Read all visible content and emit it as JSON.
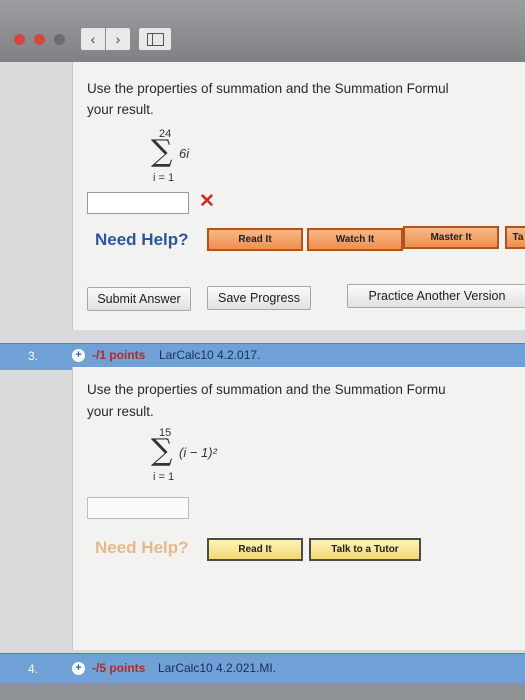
{
  "nav": {
    "back_glyph": "‹",
    "forward_glyph": "›"
  },
  "question2": {
    "prompt_line1": "Use the properties of summation and the Summation Formul",
    "prompt_line2": "your result.",
    "sum_upper": "24",
    "sum_lower": "i = 1",
    "sum_expr": "6i",
    "answer_value": "",
    "wrong_mark": "✕",
    "need_help": "Need Help?",
    "buttons": {
      "read_it": "Read It",
      "watch_it": "Watch It",
      "master_it": "Master It",
      "talk_partial": "Ta"
    },
    "submit_answer": "Submit Answer",
    "save_progress": "Save Progress",
    "practice_another": "Practice Another Version"
  },
  "question3": {
    "number": "3.",
    "plus": "+",
    "points": "-/1 points",
    "code": "LarCalc10 4.2.017.",
    "prompt_line1": "Use the properties of summation and the Summation Formu",
    "prompt_line2": "your result.",
    "sum_upper": "15",
    "sum_lower": "i = 1",
    "sum_expr": "(i − 1)²",
    "answer_value": "",
    "need_help": "Need Help?",
    "buttons": {
      "read_it": "Read It",
      "talk_to_tutor": "Talk to a Tutor"
    }
  },
  "question4": {
    "number": "4.",
    "plus": "+",
    "points": "-/5 points",
    "code": "LarCalc10 4.2.021.MI."
  }
}
